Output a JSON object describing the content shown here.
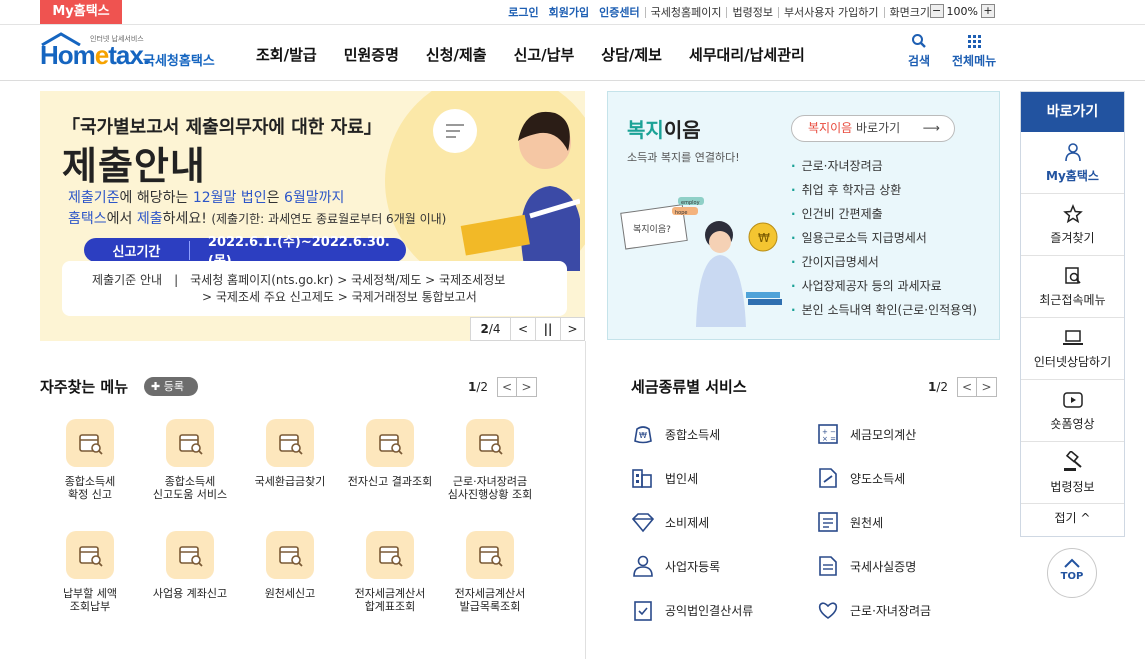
{
  "topbar": {
    "my_badge": "My홈택스",
    "links": [
      "로그인",
      "회원가입",
      "인증센터"
    ],
    "util_links": [
      "국세청홈페이지",
      "법령정보",
      "부서사용자 가입하기",
      "화면크기"
    ],
    "zoom_minus": "−",
    "zoom_value": "100%",
    "zoom_plus": "+"
  },
  "header": {
    "logo_small": "인터넷 납세서비스",
    "logo_home": "Hom",
    "logo_e": "e",
    "logo_tax": "tax.",
    "logo_kr": "국세청홈택스",
    "gnb": [
      "조회/발급",
      "민원증명",
      "신청/제출",
      "신고/납부",
      "상담/제보",
      "세무대리/납세관리"
    ],
    "search_label": "검색",
    "allmenu_label": "전체메뉴"
  },
  "banner": {
    "title1": "「국가별보고서 제출의무자에 대한 자료」",
    "title2": "제출안내",
    "line1_a": "제출기준",
    "line1_b": "에 해당하는 ",
    "line1_c": "12월말 법인",
    "line1_d": "은 ",
    "line1_e": "6월말까지",
    "line2_a": "홈택스",
    "line2_b": "에서 ",
    "line2_c": "제출",
    "line2_d": "하세요! ",
    "line2_e": "(제출기한: 과세연도 종료월로부터 6개월 이내)",
    "period_label": "신고기간",
    "period_value": "2022.6.1.(수)~2022.6.30.(목)",
    "info_label": "제출기준 안내",
    "info_line1": "국세청 홈페이지(nts.go.kr) > 국세정책/제도 > 국제조세정보",
    "info_line2": "> 국제조세 주요 신고제도 > 국제거래정보 통합보고서",
    "pager_current": "2",
    "pager_total": "/4",
    "pager_prev": "<",
    "pager_pause": "||",
    "pager_next": ">",
    "bubble_icon": "chat-lines"
  },
  "welfare": {
    "title_a": "복지",
    "title_b": "이음",
    "subtitle": "소득과 복지를 연결하다!",
    "button_a": "복지이음",
    "button_b": " 바로가기",
    "items": [
      "근로·자녀장려금",
      "취업 후 학자금 상환",
      "인건비 간편제출",
      "일용근로소득 지급명세서",
      "간이지급명세서",
      "사업장제공자 등의 과세자료",
      "본인 소득내역 확인(근로·인적용역)"
    ],
    "sign_text": "복지이음?",
    "tag1": "employ",
    "tag2": "hope"
  },
  "quick": {
    "title": "바로가기",
    "items": [
      "My홈택스",
      "즐겨찾기",
      "최근접속메뉴",
      "인터넷상담하기",
      "숏폼영상",
      "법령정보"
    ],
    "fold": "접기 ^",
    "top": "TOP"
  },
  "favorites": {
    "title": "자주찾는 메뉴",
    "register": "✚ 등록",
    "page_current": "1",
    "page_total": "/2",
    "prev": "<",
    "next": ">",
    "items": [
      [
        "종합소득세",
        "확정 신고"
      ],
      [
        "종합소득세",
        "신고도움 서비스"
      ],
      [
        "국세환급금찾기",
        ""
      ],
      [
        "전자신고 결과조회",
        ""
      ],
      [
        "근로·자녀장려금",
        "심사진행상황 조회"
      ],
      [
        "납부할 세액",
        "조회납부"
      ],
      [
        "사업용 계좌신고",
        ""
      ],
      [
        "원천세신고",
        ""
      ],
      [
        "전자세금계산서",
        "합계표조회"
      ],
      [
        "전자세금계산서",
        "발급목록조회"
      ]
    ]
  },
  "taxservice": {
    "title": "세금종류별 서비스",
    "page_current": "1",
    "page_total": "/2",
    "prev": "<",
    "next": ">",
    "left": [
      "종합소득세",
      "법인세",
      "소비제세",
      "사업자등록",
      "공익법인결산서류"
    ],
    "right": [
      "세금모의계산",
      "양도소득세",
      "원천세",
      "국세사실증명",
      "근로·자녀장려금"
    ]
  },
  "colors": {
    "brand_blue": "#2253a0",
    "badge_red": "#ef5350",
    "welfare_green": "#1aa296"
  }
}
